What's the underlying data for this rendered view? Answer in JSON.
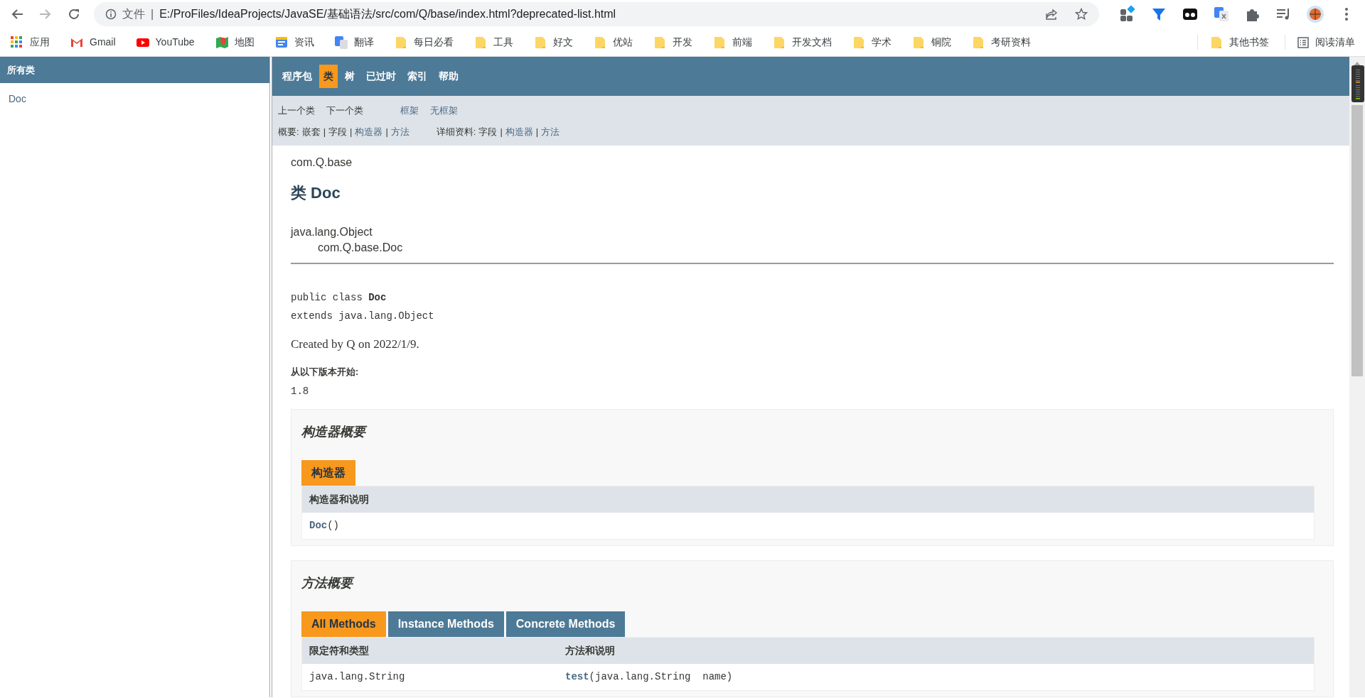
{
  "browser": {
    "nav_buttons": [
      {
        "kind": "back",
        "disabled": false
      },
      {
        "kind": "forward",
        "disabled": true
      },
      {
        "kind": "reload",
        "disabled": false
      }
    ],
    "address": {
      "scheme_label": "文件",
      "separator": "|",
      "url": "E:/ProFiles/IdeaProjects/JavaSE/基础语法/src/com/Q/base/index.html?deprecated-list.html"
    },
    "bookmarks": [
      {
        "kind": "apps",
        "label": "应用"
      },
      {
        "kind": "gmail",
        "label": "Gmail"
      },
      {
        "kind": "youtube",
        "label": "YouTube"
      },
      {
        "kind": "maps",
        "label": "地图"
      },
      {
        "kind": "news",
        "label": "资讯"
      },
      {
        "kind": "translate",
        "label": "翻译"
      },
      {
        "kind": "folder",
        "label": "每日必看"
      },
      {
        "kind": "folder",
        "label": "工具"
      },
      {
        "kind": "folder",
        "label": "好文"
      },
      {
        "kind": "folder",
        "label": "优站"
      },
      {
        "kind": "folder",
        "label": "开发"
      },
      {
        "kind": "folder",
        "label": "前端"
      },
      {
        "kind": "folder",
        "label": "开发文档"
      },
      {
        "kind": "folder",
        "label": "学术"
      },
      {
        "kind": "folder",
        "label": "铜院"
      },
      {
        "kind": "folder",
        "label": "考研资料"
      }
    ],
    "other_bookmarks": "其他书签",
    "reading_list": "阅读清单"
  },
  "class_frame": {
    "title": "所有类",
    "items": [
      "Doc"
    ]
  },
  "top_nav": [
    {
      "label": "程序包",
      "selected": false
    },
    {
      "label": "类",
      "selected": true
    },
    {
      "label": "树",
      "selected": false
    },
    {
      "label": "已过时",
      "selected": false
    },
    {
      "label": "索引",
      "selected": false
    },
    {
      "label": "帮助",
      "selected": false
    }
  ],
  "sub_nav": {
    "class_links": [
      {
        "label": "上一个类",
        "link": false
      },
      {
        "label": "下一个类",
        "link": false
      }
    ],
    "frame_links": [
      {
        "label": "框架",
        "link": true
      },
      {
        "label": "无框架",
        "link": true
      }
    ],
    "summary": {
      "label": "概要:",
      "separator": "|",
      "items": [
        {
          "label": "嵌套",
          "link": false
        },
        {
          "label": "字段",
          "link": false
        },
        {
          "label": "构造器",
          "link": true
        },
        {
          "label": "方法",
          "link": true
        }
      ]
    },
    "detail": {
      "label": "详细资料:",
      "separator": "|",
      "items": [
        {
          "label": "字段",
          "link": false
        },
        {
          "label": "构造器",
          "link": true
        },
        {
          "label": "方法",
          "link": true
        }
      ]
    }
  },
  "content": {
    "package": "com.Q.base",
    "title": "类 Doc",
    "inheritance": [
      "java.lang.Object",
      "com.Q.base.Doc"
    ],
    "signature": [
      "public class **Doc**",
      "extends java.lang.Object"
    ],
    "description": "Created by Q on 2022/1/9.",
    "since_label": "从以下版本开始:",
    "since_value": "1.8",
    "constructor_summary": {
      "heading": "构造器概要",
      "tabs": [
        {
          "label": "构造器",
          "selected": true
        }
      ],
      "columns": [
        "构造器和说明"
      ],
      "rows": [
        {
          "name": "Doc",
          "params": "()"
        }
      ]
    },
    "method_summary": {
      "heading": "方法概要",
      "tabs": [
        {
          "label": "All Methods",
          "selected": true
        },
        {
          "label": "Instance Methods",
          "selected": false
        },
        {
          "label": "Concrete Methods",
          "selected": false
        }
      ],
      "columns": [
        "限定符和类型",
        "方法和说明"
      ],
      "rows": [
        {
          "type": "java.lang.String",
          "name": "test",
          "params": "(java.lang.String  name)"
        }
      ]
    }
  }
}
